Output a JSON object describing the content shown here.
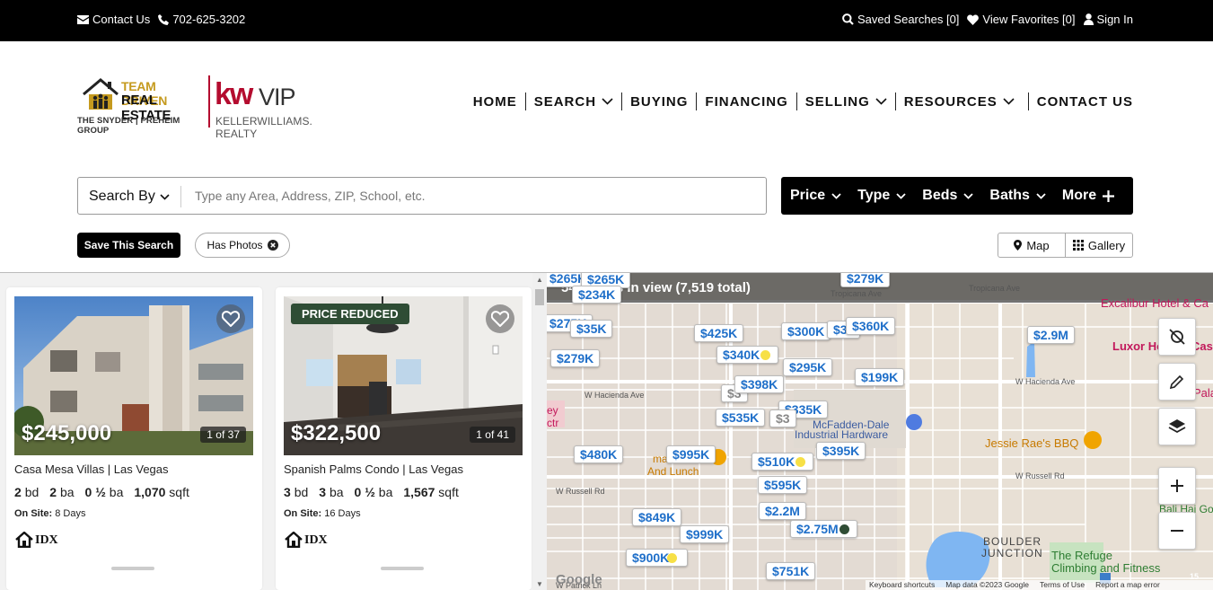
{
  "topbar": {
    "contact_label": "Contact Us",
    "phone": "702-625-3202",
    "saved_searches": "Saved Searches [0]",
    "favorites": "View Favorites [0]",
    "sign_in": "Sign In"
  },
  "logo": {
    "team_line1": "TEAM DRIVEN",
    "team_line2": "REAL ESTATE",
    "group": "THE SNYDER | PREHEIM GROUP",
    "kw": "kw",
    "vip": "VIP",
    "kw_realty": "KELLERWILLIAMS. REALTY"
  },
  "nav": {
    "items": [
      {
        "label": "HOME",
        "dropdown": false
      },
      {
        "label": "SEARCH",
        "dropdown": true
      },
      {
        "label": "BUYING",
        "dropdown": false
      },
      {
        "label": "FINANCING",
        "dropdown": false
      },
      {
        "label": "SELLING",
        "dropdown": true
      },
      {
        "label": "RESOURCES",
        "dropdown": true
      },
      {
        "label": "CONTACT US",
        "dropdown": false
      }
    ]
  },
  "search": {
    "search_by_label": "Search By",
    "placeholder": "Type any Area, Address, ZIP, School, etc."
  },
  "filters": {
    "price": "Price",
    "type": "Type",
    "beds": "Beds",
    "baths": "Baths",
    "more": "More"
  },
  "toolbar": {
    "save_search": "Save This Search",
    "has_photos": "Has Photos",
    "map": "Map",
    "gallery": "Gallery"
  },
  "listings": [
    {
      "price": "$245,000",
      "photo_count": "1 of 37",
      "name": "Casa Mesa Villas | Las Vegas",
      "beds": "2",
      "beds_unit": "bd",
      "baths": "2",
      "baths_unit": "ba",
      "half_baths": "0 ½",
      "half_unit": "ba",
      "sqft": "1,070",
      "sqft_unit": "sqft",
      "on_site_label": "On Site:",
      "on_site": "8 Days",
      "badge": ""
    },
    {
      "price": "$322,500",
      "photo_count": "1 of 41",
      "name": "Spanish Palms Condo | Las Vegas",
      "beds": "3",
      "beds_unit": "bd",
      "baths": "3",
      "baths_unit": "ba",
      "half_baths": "0 ½",
      "half_unit": "ba",
      "sqft": "1,567",
      "sqft_unit": "sqft",
      "on_site_label": "On Site:",
      "on_site": "16 Days",
      "badge": "PRICE REDUCED"
    }
  ],
  "idx_label": "IDX",
  "map": {
    "summary": "54 homes in view (7,519 total)",
    "pins": [
      "$265K",
      "$265K",
      "$234K",
      "$279K",
      "$275K",
      "$35K",
      "$279K",
      "$425K",
      "$300K",
      "$36",
      "$360K",
      "$2.9M",
      "$340K",
      "$295K",
      "$199K",
      "$398K",
      "$3",
      "$335K",
      "$535K",
      "$3",
      "$480K",
      "$995K",
      "$395K",
      "$510K",
      "$595K",
      "$2.2M",
      "$2.75M",
      "$849K",
      "$999K",
      "$900K",
      "$751K"
    ],
    "places": {
      "excalibur": "Excalibur Hotel & Ca",
      "luxor": "Luxor Ho",
      "luxor2": "Cas",
      "jessie": "Jessie Rae's BBQ",
      "mcfadden1": "McFadden-Dale",
      "mcfadden2": "Industrial Hardware",
      "boulder1": "BOULDER",
      "boulder2": "JUNCTION",
      "refuge1": "The Refuge",
      "refuge2": "Climbing and Fitness",
      "balihai": "Bali Hai Golf",
      "lunch1": "mas Bu",
      "lunch2": "And Lunch",
      "ey": "ey",
      "ctr": "ctr",
      "pala": "Pala",
      "tropicana": "Tropicana Ave",
      "hacienda": "W Hacienda Ave",
      "hacienda2": "W Hacienda Ave",
      "russell": "W Russell Rd",
      "russell2": "W Russell Rd",
      "patrick": "W Patrick Ln"
    },
    "attribution": {
      "shortcuts": "Keyboard shortcuts",
      "data": "Map data ©2023 Google",
      "terms": "Terms of Use",
      "report": "Report a map error"
    },
    "google": "Google",
    "road_15": "15"
  }
}
